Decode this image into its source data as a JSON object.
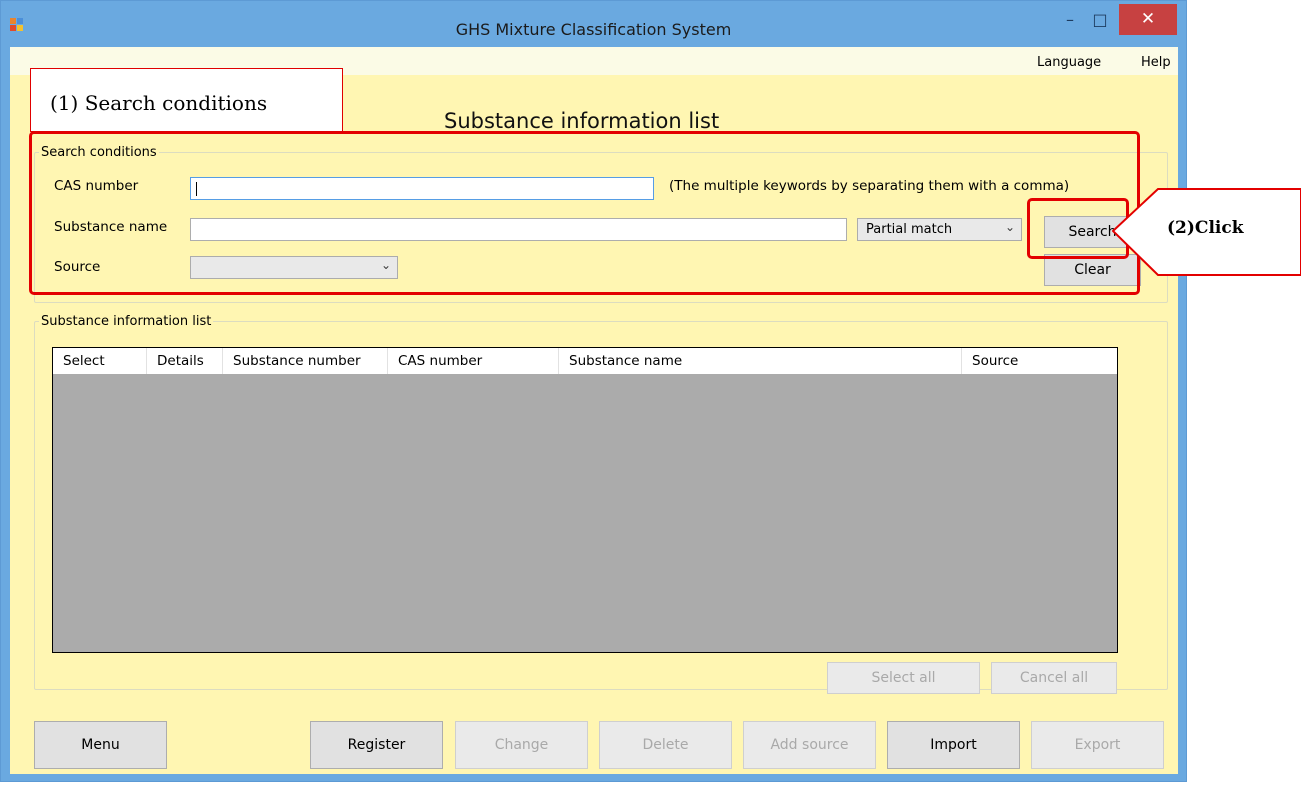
{
  "window": {
    "title": "GHS Mixture Classification System",
    "minimize_glyph": "–",
    "maximize_glyph": "□",
    "close_glyph": "✕",
    "colors": {
      "titlebar": "#6aa9e0",
      "client": "#fff6b2",
      "close": "#c74141",
      "highlight": "#e30000"
    }
  },
  "menubar": {
    "language": "Language",
    "help": "Help"
  },
  "page_title": "Substance information list",
  "search": {
    "group_label": "Search conditions",
    "cas_label": "CAS number",
    "cas_value": "",
    "cas_hint": "(The multiple keywords by separating them with a comma)",
    "name_label": "Substance name",
    "name_value": "",
    "match_mode": "Partial match",
    "source_label": "Source",
    "source_value": "",
    "search_button": "Search",
    "clear_button": "Clear"
  },
  "list": {
    "group_label": "Substance information list",
    "columns": [
      "Select",
      "Details",
      "Substance number",
      "CAS number",
      "Substance name",
      "Source"
    ],
    "select_all": "Select all",
    "cancel_all": "Cancel all"
  },
  "bottom_buttons": {
    "menu": "Menu",
    "register": "Register",
    "change": "Change",
    "delete": "Delete",
    "add_source": "Add source",
    "import": "Import",
    "export": "Export"
  },
  "annotations": {
    "step1": "(1) Search conditions",
    "step2": "(2)Click"
  }
}
